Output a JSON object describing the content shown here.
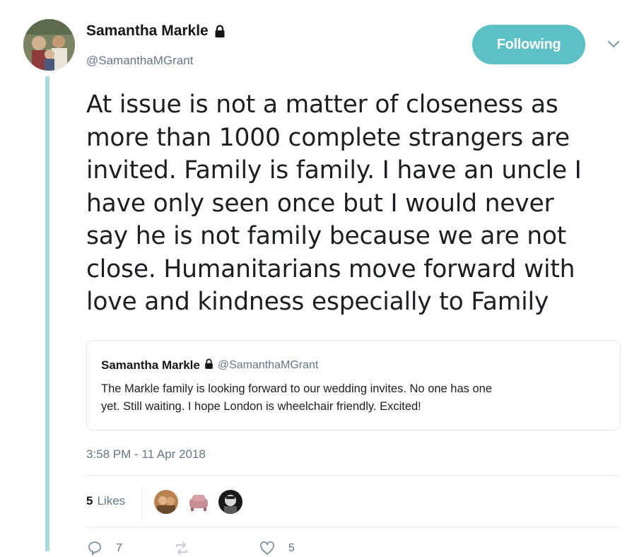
{
  "author": {
    "display_name": "Samantha Markle",
    "handle": "@SamanthaMGrant",
    "protected_icon": "lock-icon"
  },
  "follow_button": {
    "label": "Following",
    "color": "#5cc1c5"
  },
  "menu_icon": "chevron-down-icon",
  "tweet": {
    "text_lines": [
      "At issue is not a matter of closeness as",
      "more than 1000 complete strangers are",
      "invited. Family is family. I have an uncle I",
      "have only seen once but I would never",
      "say he is not family because we are not",
      "close. Humanitarians move forward with",
      "love and kindness especially to Family"
    ],
    "timestamp": "3:58 PM - 11 Apr 2018"
  },
  "quoted_tweet": {
    "display_name": "Samantha Markle",
    "handle": "@SamanthaMGrant",
    "text_lines": [
      "The Markle family is looking forward to our wedding invites.  No one has one",
      "yet. Still waiting.  I hope London is wheelchair friendly.  Excited!"
    ]
  },
  "stats": {
    "likes_count": "5",
    "likes_label": "Likes",
    "likers": [
      "liker-avatar-1",
      "liker-avatar-2",
      "liker-avatar-3"
    ]
  },
  "actions": {
    "reply_count": "7",
    "like_count": "5"
  },
  "colors": {
    "thread_line": "#a9dbe0",
    "secondary_text": "#657786"
  }
}
